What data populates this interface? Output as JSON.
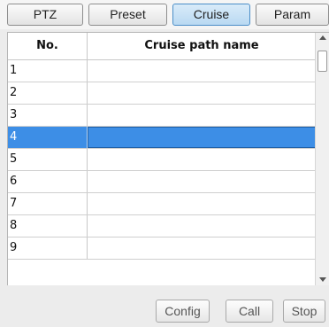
{
  "tabs": {
    "ptz": "PTZ",
    "preset": "Preset",
    "cruise": "Cruise",
    "param": "Param"
  },
  "table": {
    "col_no": "No.",
    "col_name": "Cruise path name",
    "selected_row": 4,
    "rows": [
      {
        "no": "1",
        "name": ""
      },
      {
        "no": "2",
        "name": ""
      },
      {
        "no": "3",
        "name": ""
      },
      {
        "no": "4",
        "name": ""
      },
      {
        "no": "5",
        "name": ""
      },
      {
        "no": "6",
        "name": ""
      },
      {
        "no": "7",
        "name": ""
      },
      {
        "no": "8",
        "name": ""
      },
      {
        "no": "9",
        "name": ""
      }
    ]
  },
  "buttons": {
    "config": "Config",
    "call": "Call",
    "stop": "Stop"
  },
  "colors": {
    "selection": "#3d8ee6",
    "active_tab": "#b9d9f2"
  }
}
